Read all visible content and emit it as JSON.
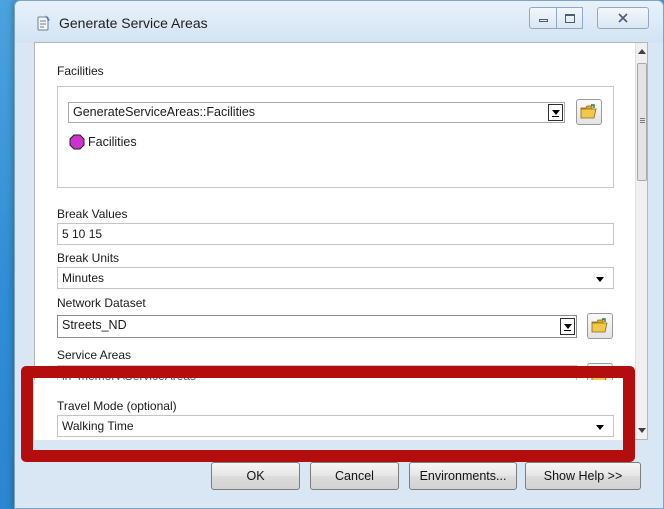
{
  "window": {
    "title": "Generate Service Areas",
    "minimize_symbol": "▭",
    "maximize_symbol": "□",
    "close_symbol": "✕"
  },
  "form": {
    "facilities": {
      "label": "Facilities",
      "layer_value": "GenerateServiceAreas::Facilities",
      "legend_item": "Facilities",
      "legend_color": "#cc33cc"
    },
    "break_values": {
      "label": "Break Values",
      "value": "5 10 15"
    },
    "break_units": {
      "label": "Break Units",
      "value": "Minutes"
    },
    "network_dataset": {
      "label": "Network Dataset",
      "value": "Streets_ND"
    },
    "service_areas": {
      "label": "Service Areas",
      "value": "in_memory\\ServiceAreas"
    },
    "travel_mode": {
      "label": "Travel Mode (optional)",
      "value": "Walking Time"
    }
  },
  "buttons": {
    "ok": "OK",
    "cancel": "Cancel",
    "environments": "Environments...",
    "show_help": "Show Help >>"
  },
  "colors": {
    "highlight": "#b40d0d",
    "folder": "#f2c84b"
  }
}
